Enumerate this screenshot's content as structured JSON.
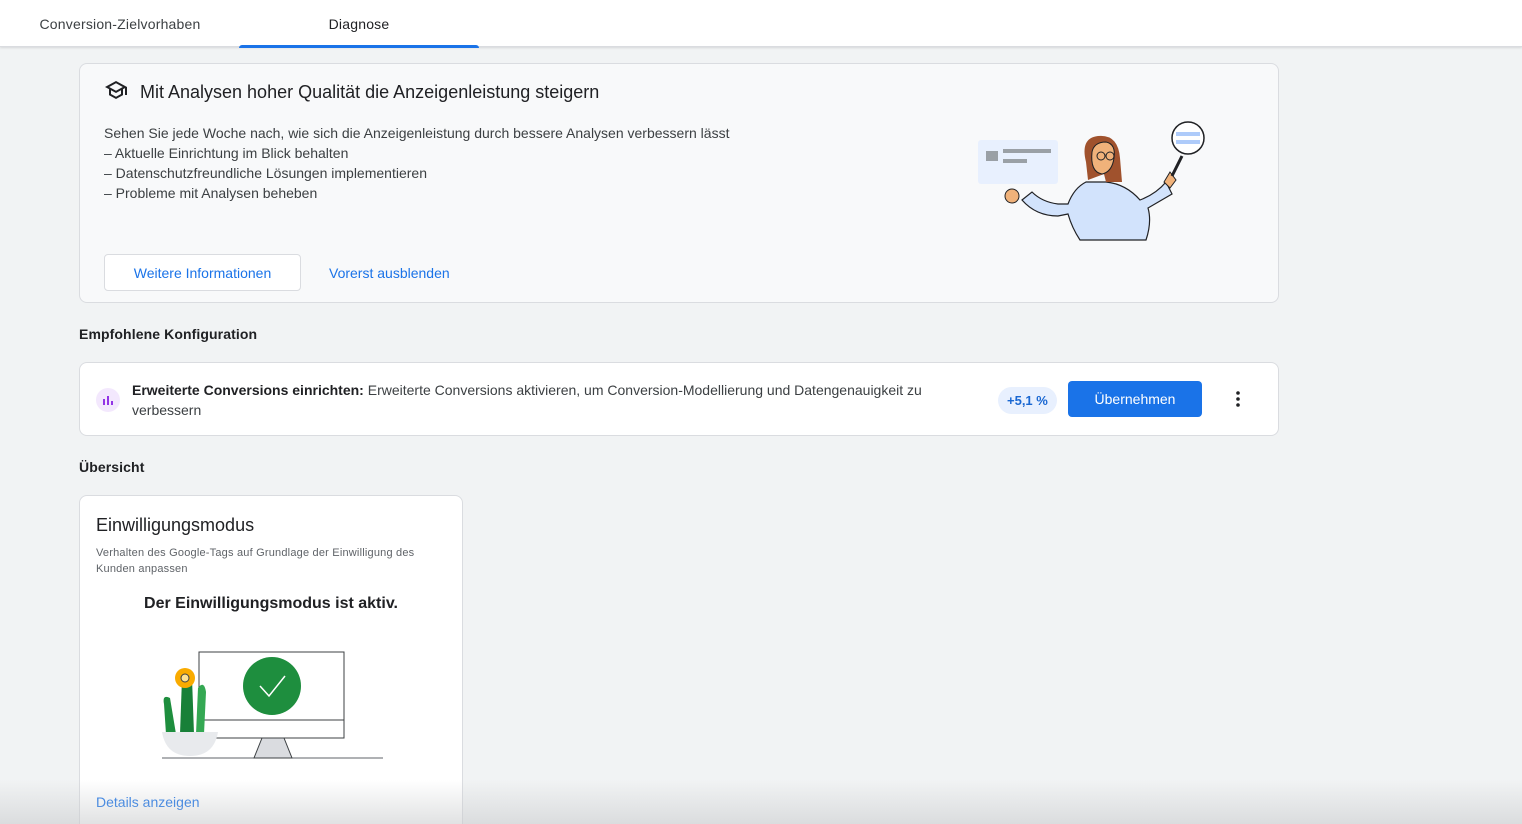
{
  "tabs": [
    {
      "label": "Conversion-Zielvorhaben",
      "active": false
    },
    {
      "label": "Diagnose",
      "active": true
    }
  ],
  "promo": {
    "title": "Mit Analysen hoher Qualität die Anzeigenleistung steigern",
    "intro": "Sehen Sie jede Woche nach, wie sich die Anzeigenleistung durch bessere Analysen verbessern lässt",
    "bullets": [
      "– Aktuelle Einrichtung im Blick behalten",
      "– Datenschutzfreundliche Lösungen implementieren",
      "– Probleme mit Analysen beheben"
    ],
    "learn_more_label": "Weitere Informationen",
    "dismiss_label": "Vorerst ausblenden"
  },
  "recommended": {
    "heading": "Empfohlene Konfiguration",
    "item": {
      "title": "Erweiterte Conversions einrichten:",
      "description": "Erweiterte Conversions aktivieren, um Conversion-Modellierung und Datengenauigkeit zu verbessern",
      "uplift": "+5,1 %",
      "apply_label": "Übernehmen"
    }
  },
  "overview": {
    "heading": "Übersicht",
    "card": {
      "title": "Einwilligungsmodus",
      "description": "Verhalten des Google-Tags auf Grundlage der Einwilligung des Kunden anpassen",
      "status": "Der Einwilligungsmodus ist aktiv.",
      "details_label": "Details anzeigen"
    }
  },
  "colors": {
    "accent": "#1a73e8",
    "success": "#1e8e3e",
    "background": "#f1f3f4"
  },
  "icons": {
    "promo": "school-cap-icon",
    "recommendation": "bar-chart-icon",
    "more": "more-vert-icon",
    "status": "check-circle-icon"
  }
}
